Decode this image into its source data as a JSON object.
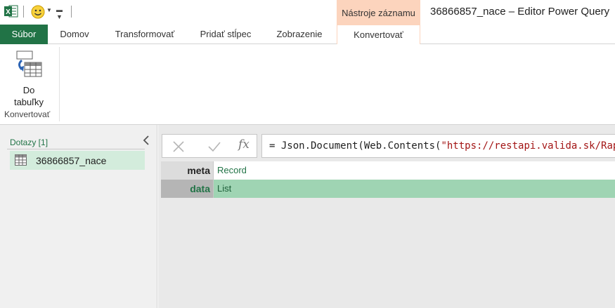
{
  "titlebar": {
    "contextual_tab": "Nástroje záznamu",
    "window_title": "36866857_nace – Editor Power Query"
  },
  "tabs": [
    {
      "label": "Súbor"
    },
    {
      "label": "Domov"
    },
    {
      "label": "Transformovať"
    },
    {
      "label": "Pridať stĺpec"
    },
    {
      "label": "Zobrazenie"
    },
    {
      "label": "Konvertovať"
    }
  ],
  "ribbon": {
    "to_table_label": "Do\ntabuľky",
    "group_label": "Konvertovať"
  },
  "queries": {
    "header": "Dotazy [1]",
    "items": [
      {
        "label": "36866857_nace"
      }
    ]
  },
  "formula_bar": {
    "prefix": "= Json.Document(Web.Contents(",
    "string": "\"https://restapi.valida.sk/Rapi"
  },
  "record": {
    "rows": [
      {
        "field": "meta",
        "value": "Record"
      },
      {
        "field": "data",
        "value": "List"
      }
    ]
  },
  "colors": {
    "accent": "#217346",
    "contextual": "#fcd4bd",
    "selected_row": "#9fd4b3"
  }
}
